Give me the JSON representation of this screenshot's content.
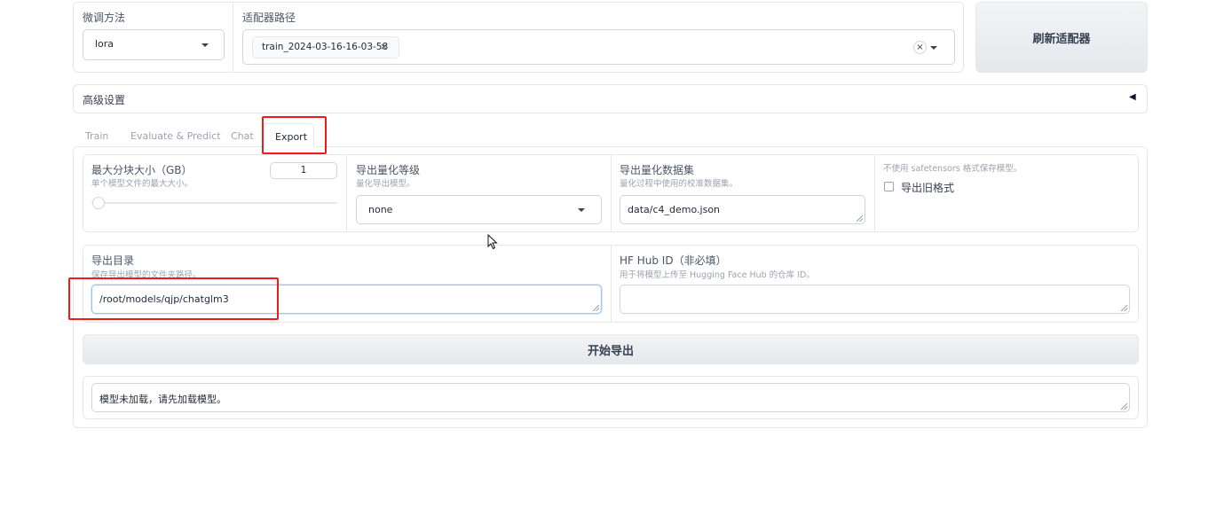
{
  "top": {
    "finetune_label": "微调方法",
    "finetune_value": "lora",
    "adapter_label": "适配器路径",
    "adapter_chip": "train_2024-03-16-16-03-58",
    "chip_close": "×",
    "clear_glyph": "×",
    "refresh_button": "刷新适配器"
  },
  "advanced": {
    "label": "高级设置",
    "toggle_glyph": "◀"
  },
  "tabs": [
    {
      "label": "Train",
      "active": false
    },
    {
      "label": "Evaluate & Predict",
      "active": false
    },
    {
      "label": "Chat",
      "active": false
    },
    {
      "label": "Export",
      "active": true
    }
  ],
  "export": {
    "max_shard": {
      "label": "最大分块大小（GB）",
      "sub": "单个模型文件的最大大小。",
      "value": "1",
      "slider_fraction": 0.0
    },
    "quant_bit": {
      "label": "导出量化等级",
      "sub": "量化导出模型。",
      "value": "none"
    },
    "quant_dataset": {
      "label": "导出量化数据集",
      "sub": "量化过程中使用的校准数据集。",
      "value": "data/c4_demo.json"
    },
    "legacy": {
      "sub": "不使用 safetensors 格式保存模型。",
      "label": "导出旧格式",
      "checked": false
    },
    "export_dir": {
      "label": "导出目录",
      "sub": "保存导出模型的文件夹路径。",
      "value": "/root/models/qjp/chatglm3"
    },
    "hub_id": {
      "label": "HF Hub ID（非必填）",
      "sub": "用于将模型上传至 Hugging Face Hub 的仓库 ID。",
      "value": ""
    },
    "start_button": "开始导出",
    "info_box": "模型未加载，请先加载模型。"
  },
  "colors": {
    "highlight": "#ef1b1b",
    "border": "#e5e7eb",
    "button_bg": "#e5e7eb"
  }
}
